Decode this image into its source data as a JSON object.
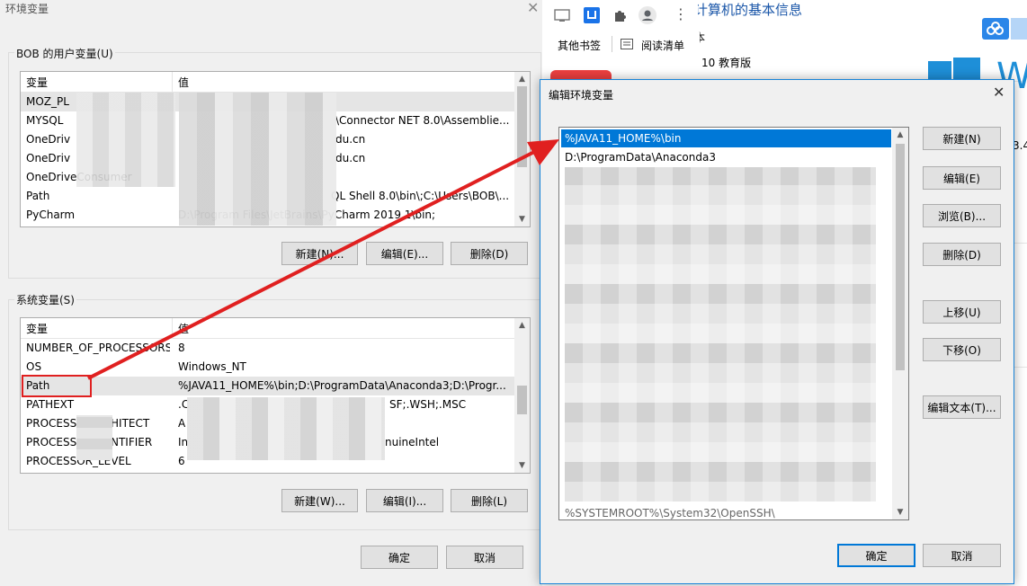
{
  "env_window": {
    "title": "环境变量",
    "close_glyph": "✕",
    "user_group_label": "BOB 的用户变量(U)",
    "user_vars": {
      "header_var": "变量",
      "header_val": "值",
      "rows": [
        {
          "name": "MOZ_PL",
          "value": ""
        },
        {
          "name": "MYSQL",
          "value": "\\Connector NET 8.0\\Assemblie..."
        },
        {
          "name": "OneDriv",
          "value": "du.cn"
        },
        {
          "name": "OneDriv",
          "value": "du.cn"
        },
        {
          "name": "OneDriveConsumer",
          "value": ""
        },
        {
          "name": "Path",
          "value": "QL Shell 8.0\\bin\\;C:\\Users\\BOB\\..."
        },
        {
          "name": "PyCharm",
          "value": "D:\\Program Files\\JetBrains\\PyCharm 2019.1\\bin;"
        }
      ]
    },
    "user_buttons": {
      "new": "新建(N)...",
      "edit": "编辑(E)...",
      "delete": "删除(D)"
    },
    "system_group_label": "系统变量(S)",
    "system_vars": {
      "header_var": "变量",
      "header_val": "值",
      "rows": [
        {
          "name": "NUMBER_OF_PROCESSORS",
          "value": "8"
        },
        {
          "name": "OS",
          "value": "Windows_NT"
        },
        {
          "name": "Path",
          "value": "%JAVA11_HOME%\\bin;D:\\ProgramData\\Anaconda3;D:\\Progr..."
        },
        {
          "name": "PATHEXT",
          "value": ".C",
          "value_tail": "SF;.WSH;.MSC"
        },
        {
          "name": "PROCESS",
          "name_tail": "HITECT",
          "value": "A"
        },
        {
          "name": "PROCESS",
          "name_tail": "NTIFIER",
          "value": "In",
          "value_tail": "nuineIntel"
        },
        {
          "name": "PROCESSOR_LEVEL",
          "value": "6"
        }
      ]
    },
    "system_buttons": {
      "new": "新建(W)...",
      "edit": "编辑(I)...",
      "delete": "删除(L)"
    },
    "ok": "确定",
    "cancel": "取消"
  },
  "browser": {
    "bookmark_other": "其他书签",
    "reading_list": "阅读清单",
    "page_heading": "计算机的基本信息",
    "text_ben": "本",
    "edition": "10 教育版",
    "side_number": "3.4",
    "brand_color": "#0078d7"
  },
  "edit_dialog": {
    "title": "编辑环境变量",
    "close_glyph": "✕",
    "items": [
      "%JAVA11_HOME%\\bin",
      "D:\\ProgramData\\Anaconda3"
    ],
    "last_item": "%SYSTEMROOT%\\System32\\OpenSSH\\",
    "buttons": {
      "new": "新建(N)",
      "edit": "编辑(E)",
      "browse": "浏览(B)...",
      "delete": "删除(D)",
      "move_up": "上移(U)",
      "move_down": "下移(O)",
      "edit_text": "编辑文本(T)..."
    },
    "ok": "确定",
    "cancel": "取消"
  },
  "annotation": {
    "color": "#e02020"
  }
}
